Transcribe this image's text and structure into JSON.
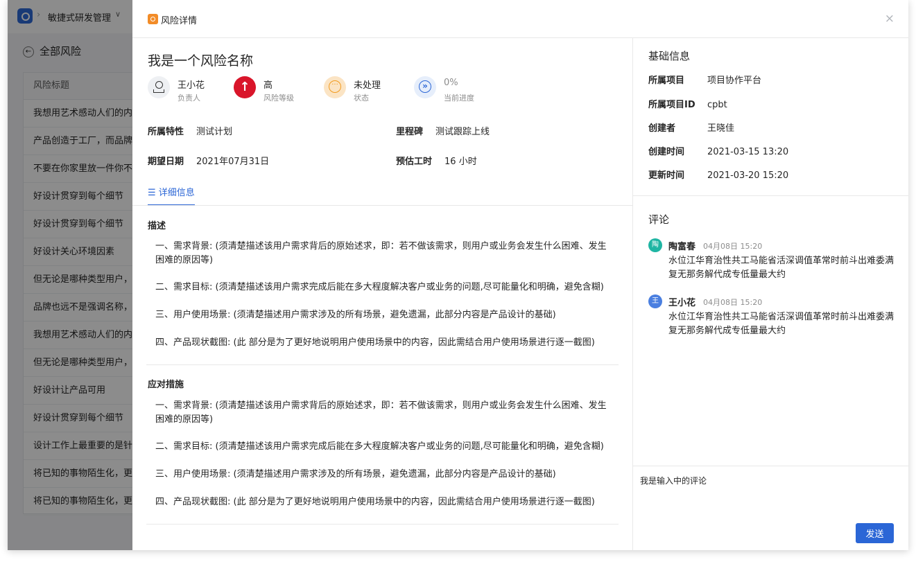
{
  "background": {
    "project_name": "敏捷式研发管理",
    "back_label": "全部风险",
    "column_header": "风险标题",
    "rows": [
      "我想用艺术感动人们的内心",
      "产品创造于工厂，而品牌创",
      "不要在你家里放一件你不知",
      "好设计贯穿到每个细节",
      "好设计贯穿到每个细节",
      "好设计关心环境因素",
      "但无论是哪种类型用户，都",
      "品牌也远不是强调名称，标",
      "我想用艺术感动人们的内心",
      "但无论是哪种类型用户，都",
      "好设计让产品可用",
      "好设计贯穿到每个细节",
      "设计工作上最重要的是针对",
      "将已知的事物陌生化，更是",
      "将已知的事物陌生化，更是"
    ]
  },
  "drawer": {
    "title": "风险详情",
    "close_glyph": "×"
  },
  "risk": {
    "name": "我是一个风险名称",
    "stats": {
      "owner": {
        "value": "王小花",
        "label": "负责人"
      },
      "level": {
        "value": "高",
        "label": "风险等级",
        "glyph": "↑"
      },
      "status": {
        "value": "未处理",
        "label": "状态"
      },
      "progress": {
        "value": "0%",
        "label": "当前进度"
      }
    },
    "fields": {
      "feature": {
        "label": "所属特性",
        "value": "测试计划"
      },
      "milestone": {
        "label": "里程碑",
        "value": "测试跟踪上线"
      },
      "expected_date": {
        "label": "期望日期",
        "value": "2021年07月31日"
      },
      "estimated_hours": {
        "label": "预估工时",
        "value": "16 小时"
      }
    },
    "tab_label": "☰ 详细信息",
    "description": {
      "title": "描述",
      "paragraphs": [
        "一、需求背景: (须清楚描述该用户需求背后的原始述求，即：若不做该需求，则用户或业务会发生什么困难、发生困难的原因等)",
        "二、需求目标: (须清楚描述该用户需求完成后能在多大程度解决客户或业务的问题,尽可能量化和明确，避免含糊)",
        "三、用户使用场景: (须清楚描述用户需求涉及的所有场景，避免遗漏，此部分内容是产品设计的基础)",
        "四、产品现状截图: (此 部分是为了更好地说明用户使用场景中的内容，因此需结合用户使用场景进行逐一截图)"
      ]
    },
    "measures": {
      "title": "应对措施",
      "paragraphs": [
        "一、需求背景: (须清楚描述该用户需求背后的原始述求，即：若不做该需求，则用户或业务会发生什么困难、发生困难的原因等)",
        "二、需求目标: (须清楚描述该用户需求完成后能在多大程度解决客户或业务的问题,尽可能量化和明确，避免含糊)",
        "三、用户使用场景: (须清楚描述用户需求涉及的所有场景，避免遗漏，此部分内容是产品设计的基础)",
        "四、产品现状截图: (此 部分是为了更好地说明用户使用场景中的内容，因此需结合用户使用场景进行逐一截图)"
      ]
    }
  },
  "basic_info": {
    "title": "基础信息",
    "rows": [
      {
        "label": "所属项目",
        "value": "项目协作平台"
      },
      {
        "label": "所属项目ID",
        "value": "cpbt"
      },
      {
        "label": "创建者",
        "value": "王晓佳"
      },
      {
        "label": "创建时间",
        "value": "2021-03-15 13:20"
      },
      {
        "label": "更新时间",
        "value": "2021-03-20 15:20"
      }
    ]
  },
  "comments": {
    "title": "评论",
    "items": [
      {
        "avatar": "陶",
        "avatar_color": "#1fb5a3",
        "name": "陶富春",
        "time": "04月08日 15:20",
        "text": "水位江华育治性共工马能省活深调值革常时前斗出难委满复无那务解代成专低量最大约"
      },
      {
        "avatar": "王",
        "avatar_color": "#4a7fe0",
        "name": "王小花",
        "time": "04月08日 15:20",
        "text": "水位江华育治性共工马能省活深调值革常时前斗出难委满复无那务解代成专低量最大约"
      }
    ],
    "input_value": "我是输入中的评论",
    "send_label": "发送"
  },
  "colors": {
    "primary": "#2b66d6",
    "danger": "#d9152a",
    "warning": "#f29b1f",
    "title_icon": "#f28c28"
  },
  "icons": {
    "logo": "app-logo-icon",
    "back": "back-arrow-icon",
    "title": "risk-detail-icon",
    "owner": "user-icon",
    "level": "arrow-up-icon",
    "status": "pending-icon",
    "progress": "double-chevron-icon",
    "close": "close-icon"
  }
}
